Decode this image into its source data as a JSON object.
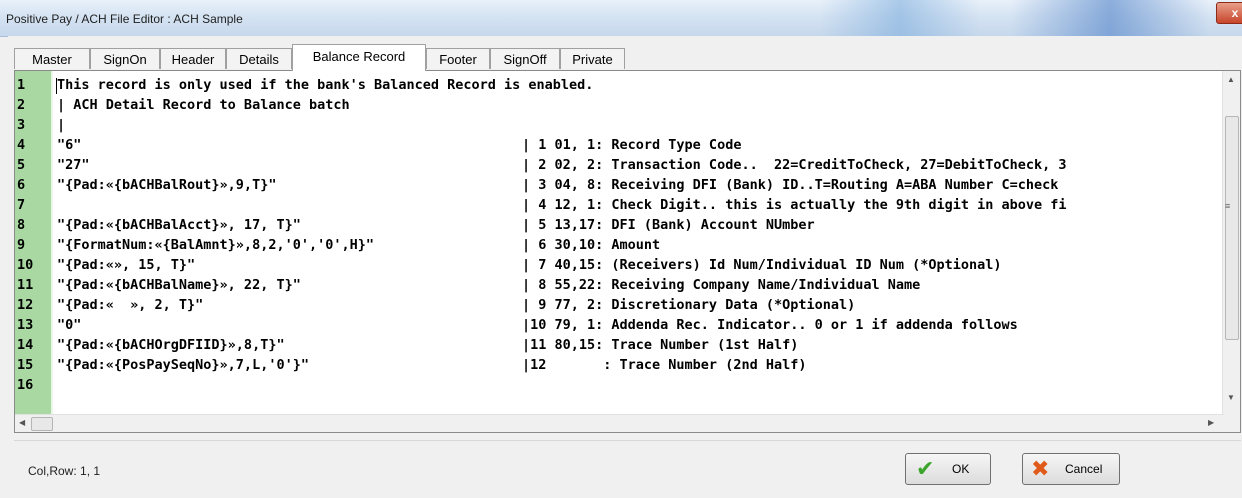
{
  "window": {
    "title": "Positive Pay / ACH File  Editor : ACH Sample",
    "close_label": "x"
  },
  "tabs": [
    {
      "label": "Master"
    },
    {
      "label": "SignOn"
    },
    {
      "label": "Header"
    },
    {
      "label": "Details"
    },
    {
      "label": "Balance Record",
      "active": true
    },
    {
      "label": "Footer"
    },
    {
      "label": "SignOff"
    },
    {
      "label": "Private"
    }
  ],
  "editor": {
    "lines": [
      {
        "num": "1",
        "code": "This record is only used if the bank's Balanced Record is enabled.",
        "desc": ""
      },
      {
        "num": "2",
        "code": "| ACH Detail Record to Balance batch",
        "desc": ""
      },
      {
        "num": "3",
        "code": "|",
        "desc": ""
      },
      {
        "num": "4",
        "code": "\"6\"",
        "desc": "| 1 01, 1: Record Type Code"
      },
      {
        "num": "5",
        "code": "\"27\"",
        "desc": "| 2 02, 2: Transaction Code..  22=CreditToCheck, 27=DebitToCheck, 3"
      },
      {
        "num": "6",
        "code": "\"{Pad:«{bACHBalRout}»,9,T}\"",
        "desc": "| 3 04, 8: Receiving DFI (Bank) ID..T=Routing A=ABA Number C=check"
      },
      {
        "num": "7",
        "code": "",
        "desc": "| 4 12, 1: Check Digit.. this is actually the 9th digit in above fi"
      },
      {
        "num": "8",
        "code": "\"{Pad:«{bACHBalAcct}», 17, T}\"",
        "desc": "| 5 13,17: DFI (Bank) Account NUmber"
      },
      {
        "num": "9",
        "code": "\"{FormatNum:«{BalAmnt}»,8,2,'0','0',H}\"",
        "desc": "| 6 30,10: Amount"
      },
      {
        "num": "10",
        "code": "\"{Pad:«», 15, T}\"",
        "desc": "| 7 40,15: (Receivers) Id Num/Individual ID Num (*Optional)"
      },
      {
        "num": "11",
        "code": "\"{Pad:«{bACHBalName}», 22, T}\"",
        "desc": "| 8 55,22: Receiving Company Name/Individual Name"
      },
      {
        "num": "12",
        "code": "\"{Pad:«  », 2, T}\"",
        "desc": "| 9 77, 2: Discretionary Data (*Optional)"
      },
      {
        "num": "13",
        "code": "\"0\"",
        "desc": "|10 79, 1: Addenda Rec. Indicator.. 0 or 1 if addenda follows"
      },
      {
        "num": "14",
        "code": "\"{Pad:«{bACHOrgDFIID}»,8,T}\"",
        "desc": "|11 80,15: Trace Number (1st Half)"
      },
      {
        "num": "15",
        "code": "\"{Pad:«{PosPaySeqNo}»,7,L,'0'}\"",
        "desc": "|12       : Trace Number (2nd Half)"
      },
      {
        "num": "16",
        "code": "",
        "desc": ""
      }
    ]
  },
  "status": {
    "text": "Col,Row: 1, 1"
  },
  "buttons": {
    "ok_label": "OK",
    "cancel_label": "Cancel"
  },
  "icons": {
    "ok": "check-icon",
    "cancel": "cross-icon"
  }
}
